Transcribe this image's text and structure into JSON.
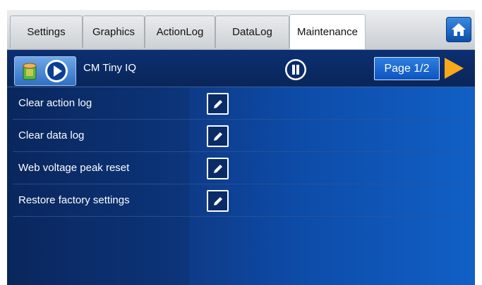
{
  "tabs": [
    {
      "label": "Settings"
    },
    {
      "label": "Graphics"
    },
    {
      "label": "ActionLog"
    },
    {
      "label": "DataLog"
    },
    {
      "label": "Maintenance"
    }
  ],
  "active_tab": "Maintenance",
  "header": {
    "title": "CM Tiny IQ",
    "page_label": "Page 1/2"
  },
  "rows": [
    {
      "label": "Clear action log"
    },
    {
      "label": "Clear data log"
    },
    {
      "label": "Web voltage peak reset"
    },
    {
      "label": "Restore factory settings"
    }
  ],
  "icons": {
    "home": "home-icon",
    "device": "device-icon",
    "play": "play-icon",
    "pause": "pause-icon",
    "next": "next-arrow-icon",
    "edit": "edit-pencil-icon"
  },
  "colors": {
    "accent_orange": "#f7a81b",
    "panel_blue": "#0d4aa6",
    "header_blue": "#0a2659"
  }
}
